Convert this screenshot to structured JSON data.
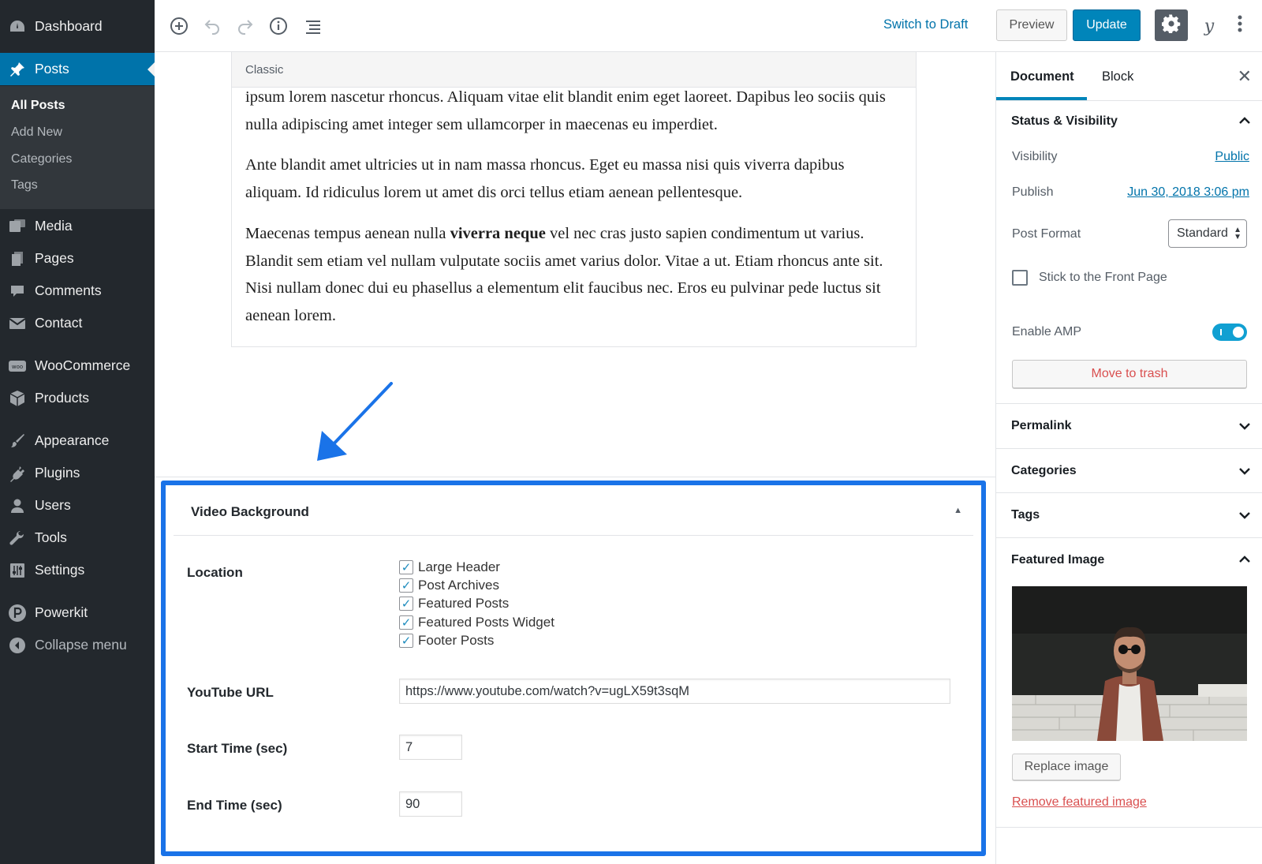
{
  "sidebar": {
    "items": [
      {
        "label": "Dashboard",
        "icon": "dashboard-icon"
      },
      {
        "label": "Posts",
        "icon": "pin-icon"
      },
      {
        "label": "Media",
        "icon": "media-icon"
      },
      {
        "label": "Pages",
        "icon": "pages-icon"
      },
      {
        "label": "Comments",
        "icon": "comment-icon"
      },
      {
        "label": "Contact",
        "icon": "mail-icon"
      },
      {
        "label": "WooCommerce",
        "icon": "woo-icon"
      },
      {
        "label": "Products",
        "icon": "box-icon"
      },
      {
        "label": "Appearance",
        "icon": "brush-icon"
      },
      {
        "label": "Plugins",
        "icon": "plug-icon"
      },
      {
        "label": "Users",
        "icon": "user-icon"
      },
      {
        "label": "Tools",
        "icon": "wrench-icon"
      },
      {
        "label": "Settings",
        "icon": "sliders-icon"
      },
      {
        "label": "Powerkit",
        "icon": "powerkit-icon"
      },
      {
        "label": "Collapse menu",
        "icon": "collapse-icon"
      }
    ],
    "submenu": [
      "All Posts",
      "Add New",
      "Categories",
      "Tags"
    ]
  },
  "toolbar": {
    "switch_draft": "Switch to Draft",
    "preview": "Preview",
    "update": "Update",
    "yoast": "y"
  },
  "editor": {
    "block_label": "Classic",
    "paragraphs": {
      "p1": "ipsum lorem nascetur rhoncus. Aliquam vitae elit blandit enim eget laoreet. Dapibus leo sociis quis nulla adipiscing amet integer sem ullamcorper in maecenas eu imperdiet.",
      "p2": "Ante blandit amet ultricies ut in nam massa rhoncus. Eget eu massa nisi quis viverra dapibus aliquam. Id ridiculus lorem ut amet dis orci tellus etiam aenean pellentesque.",
      "p3_before": "Maecenas tempus aenean nulla ",
      "p3_bold": "viverra neque",
      "p3_after": " vel nec cras justo sapien condimentum ut varius. Blandit sem etiam vel nullam vulputate sociis amet varius dolor. Vitae a ut. Etiam rhoncus ante sit. Nisi nullam donec dui eu phasellus a elementum elit faucibus nec. Eros eu pulvinar pede luctus sit aenean lorem."
    }
  },
  "video_background": {
    "title": "Video Background",
    "location_label": "Location",
    "locations": [
      {
        "label": "Large Header",
        "checked": true
      },
      {
        "label": "Post Archives",
        "checked": true
      },
      {
        "label": "Featured Posts",
        "checked": true
      },
      {
        "label": "Featured Posts Widget",
        "checked": true
      },
      {
        "label": "Footer Posts",
        "checked": true
      }
    ],
    "youtube_label": "YouTube URL",
    "youtube_value": "https://www.youtube.com/watch?v=ugLX59t3sqM",
    "start_label": "Start Time (sec)",
    "start_value": "7",
    "end_label": "End Time (sec)",
    "end_value": "90"
  },
  "panel": {
    "tabs": [
      "Document",
      "Block"
    ],
    "status_title": "Status & Visibility",
    "visibility_label": "Visibility",
    "visibility_value": "Public",
    "publish_label": "Publish",
    "publish_value": "Jun 30, 2018 3:06 pm",
    "format_label": "Post Format",
    "format_value": "Standard",
    "sticky_label": "Stick to the Front Page",
    "amp_label": "Enable AMP",
    "amp_enabled": true,
    "trash": "Move to trash",
    "permalink": "Permalink",
    "categories": "Categories",
    "tags": "Tags",
    "featured_title": "Featured Image",
    "replace": "Replace image",
    "remove": "Remove featured image"
  },
  "colors": {
    "accent": "#0085ba",
    "highlight_border": "#1a73e8",
    "sidebar_bg": "#23282d",
    "danger": "#d94f4f"
  }
}
